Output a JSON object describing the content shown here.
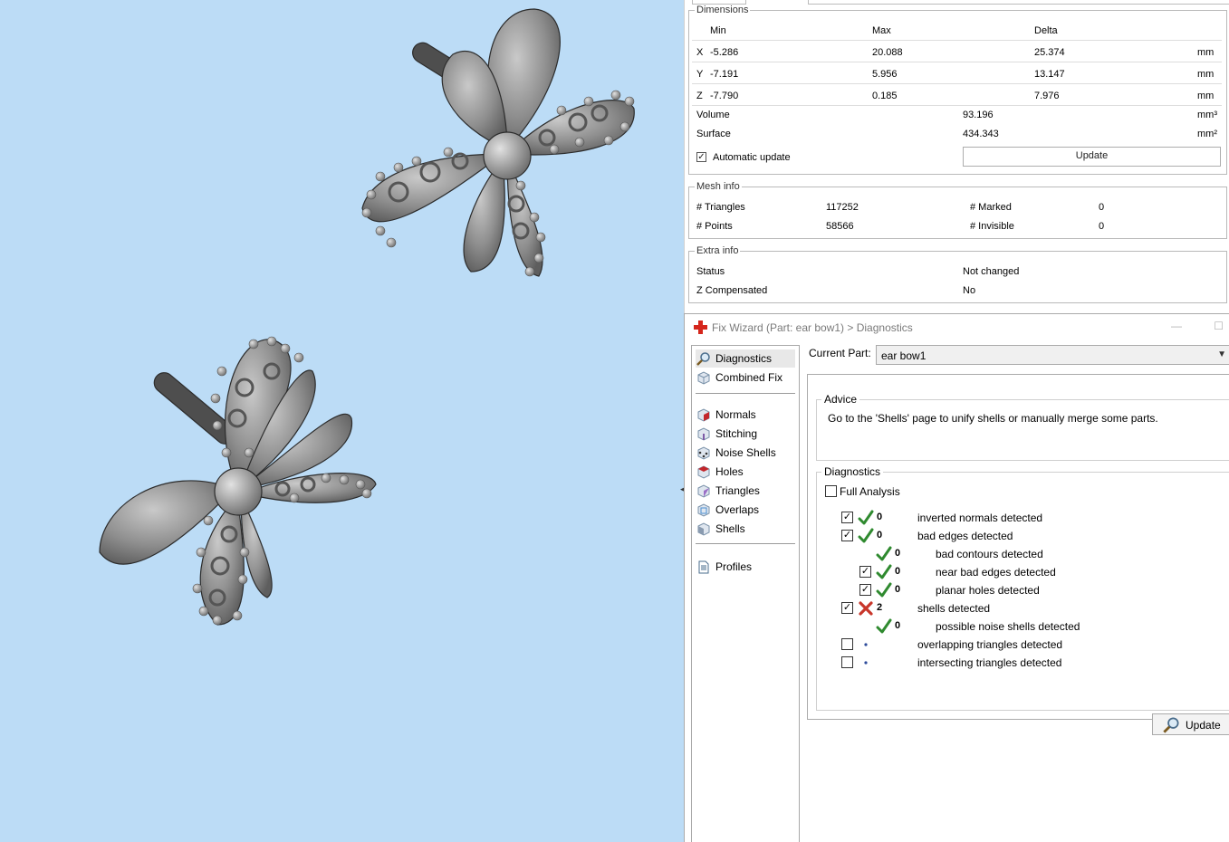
{
  "dimensions": {
    "legend": "Dimensions",
    "headers": {
      "min": "Min",
      "max": "Max",
      "delta": "Delta"
    },
    "rows": [
      {
        "axis": "X",
        "min": "-5.286",
        "max": "20.088",
        "delta": "25.374",
        "unit": "mm"
      },
      {
        "axis": "Y",
        "min": "-7.191",
        "max": "5.956",
        "delta": "13.147",
        "unit": "mm"
      },
      {
        "axis": "Z",
        "min": "-7.790",
        "max": "0.185",
        "delta": "7.976",
        "unit": "mm"
      }
    ],
    "volume_label": "Volume",
    "volume_value": "93.196",
    "volume_unit": "mm³",
    "surface_label": "Surface",
    "surface_value": "434.343",
    "surface_unit": "mm²",
    "auto_update_label": "Automatic update",
    "auto_update_checked": true,
    "update_button": "Update"
  },
  "mesh_info": {
    "legend": "Mesh info",
    "triangles_label": "# Triangles",
    "triangles_value": "117252",
    "marked_label": "# Marked",
    "marked_value": "0",
    "points_label": "# Points",
    "points_value": "58566",
    "invisible_label": "# Invisible",
    "invisible_value": "0"
  },
  "extra_info": {
    "legend": "Extra info",
    "status_label": "Status",
    "status_value": "Not changed",
    "zcomp_label": "Z Compensated",
    "zcomp_value": "No"
  },
  "wizard": {
    "title": "Fix Wizard (Part: ear bow1) > Diagnostics",
    "nav": [
      {
        "label": "Diagnostics",
        "icon": "magnifier-icon"
      },
      {
        "label": "Combined Fix",
        "icon": "cube-icon"
      },
      {
        "label": "Normals",
        "icon": "normals-cube-icon"
      },
      {
        "label": "Stitching",
        "icon": "stitching-cube-icon"
      },
      {
        "label": "Noise Shells",
        "icon": "noise-shells-icon"
      },
      {
        "label": "Holes",
        "icon": "holes-cube-icon"
      },
      {
        "label": "Triangles",
        "icon": "triangles-cube-icon"
      },
      {
        "label": "Overlaps",
        "icon": "overlaps-cube-icon"
      },
      {
        "label": "Shells",
        "icon": "shells-cube-icon"
      },
      {
        "label": "Profiles",
        "icon": "document-icon"
      }
    ],
    "current_part_label": "Current Part:",
    "current_part_value": "ear bow1",
    "advice_legend": "Advice",
    "advice_text": "Go to the 'Shells' page to unify shells or manually merge some parts.",
    "diagnostics_legend": "Diagnostics",
    "full_analysis_label": "Full Analysis",
    "items": [
      {
        "checkbox": true,
        "status": "ok",
        "count": "0",
        "label": "inverted normals detected",
        "indent": 0
      },
      {
        "checkbox": true,
        "status": "ok",
        "count": "0",
        "label": "bad edges detected",
        "indent": 0
      },
      {
        "checkbox": null,
        "status": "ok",
        "count": "0",
        "label": "bad contours detected",
        "indent": 1
      },
      {
        "checkbox": true,
        "status": "ok",
        "count": "0",
        "label": "near bad edges detected",
        "indent": 1
      },
      {
        "checkbox": true,
        "status": "ok",
        "count": "0",
        "label": "planar holes detected",
        "indent": 1
      },
      {
        "checkbox": true,
        "status": "error",
        "count": "2",
        "label": "shells detected",
        "indent": 0
      },
      {
        "checkbox": null,
        "status": "ok",
        "count": "0",
        "label": "possible noise shells detected",
        "indent": 1
      },
      {
        "checkbox": false,
        "status": "none",
        "count": "",
        "label": "overlapping triangles detected",
        "indent": 0
      },
      {
        "checkbox": false,
        "status": "none",
        "count": "",
        "label": "intersecting triangles detected",
        "indent": 0
      }
    ],
    "update_button": "Update"
  },
  "colors": {
    "viewport_bg": "#bcdcf6",
    "model": "#8a8a8a",
    "ok": "#2f8a2f",
    "error": "#c8362a"
  }
}
